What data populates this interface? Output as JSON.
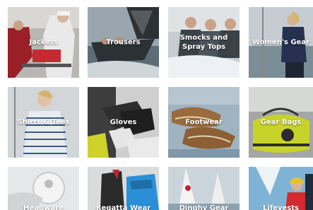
{
  "categories": [
    {
      "label": "Jackets"
    },
    {
      "label": "Trousers"
    },
    {
      "label": "Smocks and\nSpray Tops"
    },
    {
      "label": "Women's Gear"
    },
    {
      "label": "Shirts & Tees"
    },
    {
      "label": "Gloves"
    },
    {
      "label": "Footwear"
    },
    {
      "label": "Gear Bags"
    },
    {
      "label": "Headware"
    },
    {
      "label": "Regatta Wear"
    },
    {
      "label": "Dinghy Gear"
    },
    {
      "label": "Lifevests"
    }
  ]
}
